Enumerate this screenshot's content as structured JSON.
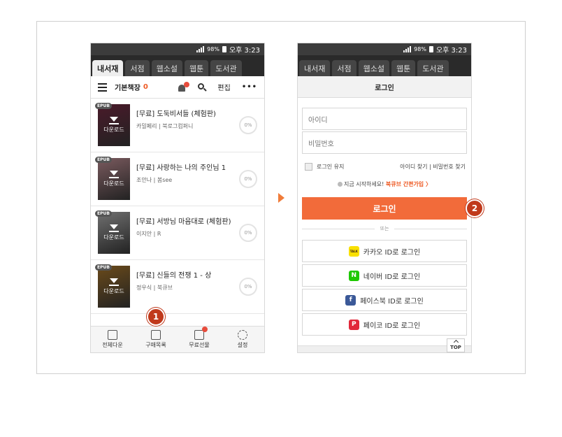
{
  "statusbar": {
    "battery_pct": "98%",
    "time": "오후 3:23"
  },
  "tabs": [
    "내서재",
    "서점",
    "웹소설",
    "웹툰",
    "도서관"
  ],
  "left": {
    "toolbar": {
      "shelf_title": "기본책장",
      "shelf_count": "0",
      "edit_label": "편집",
      "more_label": "•••"
    },
    "download_label": "다운로드",
    "epub_label": "EPUB",
    "books": [
      {
        "title": "[무료] 도둑비서들 (체험판)",
        "meta": "카밀페리 | 북로그컴퍼니",
        "progress": "0%",
        "cover_color": "#4a1a2a"
      },
      {
        "title": "[무료] 사랑하는 나의 주인님 1",
        "meta": "조안나 | 봄see",
        "progress": "0%",
        "cover_color": "#7a5a5e"
      },
      {
        "title": "[무료] 서방님 마음대로 (체험판)",
        "meta": "이지안 | R",
        "progress": "0%",
        "cover_color": "#707070"
      },
      {
        "title": "[무료] 신들의 전쟁 1 - 상",
        "meta": "정우식 | 북큐브",
        "progress": "0%",
        "cover_color": "#6a4a1a"
      }
    ],
    "bottomnav": [
      "전체다운",
      "구매목록",
      "무료선물",
      "설정"
    ],
    "badge": "1"
  },
  "right": {
    "header": "로그인",
    "id_placeholder": "아이디",
    "pw_placeholder": "비밀번호",
    "keep_login": "로그인 유지",
    "find_links": "아이디 찾기  |  비밀번호 찾기",
    "join_prompt": "지금 시작하세요!",
    "join_link": "북큐브 간편가입 〉",
    "login_button": "로그인",
    "or_label": "또는",
    "social": [
      {
        "label": "카카오 ID로 로그인",
        "icon": "kakao-icon",
        "color": "#f9e000",
        "glyph": "TALK"
      },
      {
        "label": "네이버 ID로 로그인",
        "icon": "naver-icon",
        "color": "#1ec800",
        "glyph": "N"
      },
      {
        "label": "페이스북 ID로 로그인",
        "icon": "facebook-icon",
        "color": "#3b5998",
        "glyph": "f"
      },
      {
        "label": "페이코 ID로 로그인",
        "icon": "payco-icon",
        "color": "#e1283a",
        "glyph": "P"
      }
    ],
    "top_label": "TOP",
    "badge": "2"
  }
}
